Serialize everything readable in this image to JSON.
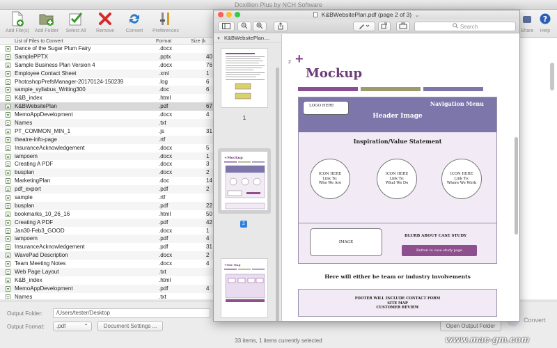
{
  "app": {
    "title": "Doxillion Plus by NCH Software",
    "toolbar": [
      {
        "label": "Add File(s)",
        "icon": "add-file-icon"
      },
      {
        "label": "Add Folder",
        "icon": "add-folder-icon"
      },
      {
        "label": "Select All",
        "icon": "select-all-icon"
      },
      {
        "label": "Remove",
        "icon": "remove-icon"
      },
      {
        "label": "Convert",
        "icon": "convert-icon"
      },
      {
        "label": "Preferences",
        "icon": "preferences-icon"
      }
    ],
    "toolbar_right": [
      {
        "label": "Share",
        "icon": "share-icon"
      },
      {
        "label": "Help",
        "icon": "help-icon"
      }
    ],
    "list_headers": {
      "name": "List of Files to Convert",
      "format": "Format",
      "size": "Size (k"
    },
    "files": [
      {
        "name": "Dance of the Sugar Plum Fairy",
        "format": ".docx",
        "size": ""
      },
      {
        "name": "SamplePPTX",
        "format": ".pptx",
        "size": "40"
      },
      {
        "name": "Sample Business Plan Version 4",
        "format": ".docx",
        "size": "76"
      },
      {
        "name": "Employee Contact Sheet",
        "format": ".xml",
        "size": "1"
      },
      {
        "name": "PhotoshopPrefsManager-20170124-150239",
        "format": ".log",
        "size": "6"
      },
      {
        "name": "sample_syllabus_Writing300",
        "format": ".doc",
        "size": "6"
      },
      {
        "name": "K&B_index",
        "format": ".html",
        "size": ""
      },
      {
        "name": "K&BWebsitePlan",
        "format": ".pdf",
        "size": "67"
      },
      {
        "name": "MemoAppDevelopment",
        "format": ".docx",
        "size": "4"
      },
      {
        "name": "Names",
        "format": ".txt",
        "size": ""
      },
      {
        "name": "PT_COMMON_MIN_1",
        "format": ".js",
        "size": "31"
      },
      {
        "name": "theatre-info-page",
        "format": ".rtf",
        "size": ""
      },
      {
        "name": "InsuranceAcknowledgement",
        "format": ".docx",
        "size": "5"
      },
      {
        "name": "iampoem",
        "format": ".docx",
        "size": "1"
      },
      {
        "name": "Creating A PDF",
        "format": ".docx",
        "size": "3"
      },
      {
        "name": "busplan",
        "format": ".docx",
        "size": "2"
      },
      {
        "name": "MarketingPlan",
        "format": ".doc",
        "size": "14"
      },
      {
        "name": "pdf_export",
        "format": ".pdf",
        "size": "2"
      },
      {
        "name": "sample",
        "format": ".rtf",
        "size": ""
      },
      {
        "name": "busplan",
        "format": ".pdf",
        "size": "22"
      },
      {
        "name": "bookmarks_10_26_16",
        "format": ".html",
        "size": "50"
      },
      {
        "name": "Creating A PDF",
        "format": ".pdf",
        "size": "42"
      },
      {
        "name": "Jan30-Feb3_GOOD",
        "format": ".docx",
        "size": "1"
      },
      {
        "name": "iampoem",
        "format": ".pdf",
        "size": "4"
      },
      {
        "name": "InsuranceAcknowledgement",
        "format": ".pdf",
        "size": "31"
      },
      {
        "name": "WavePad Description",
        "format": ".docx",
        "size": "2"
      },
      {
        "name": "Team Meeting Notes",
        "format": ".docx",
        "size": "4"
      },
      {
        "name": "Web Page Layout",
        "format": ".txt",
        "size": ""
      },
      {
        "name": "K&B_index",
        "format": ".html",
        "size": ""
      },
      {
        "name": "MemoAppDevelopment",
        "format": ".pdf",
        "size": "4"
      },
      {
        "name": "Names",
        "format": ".txt",
        "size": ""
      }
    ],
    "selected_index": 7,
    "output_folder_label": "Output Folder:",
    "output_folder_value": "/Users/tester/Desktop",
    "output_format_label": "Output Format:",
    "output_format_value": ".pdf",
    "document_settings": "Document Settings ...",
    "open_output_folder": "Open Output Folder",
    "convert": "Convert",
    "status": "33 items, 1 items currently selected"
  },
  "preview": {
    "title": "K&BWebsitePlan.pdf (page 2 of 3)",
    "search_placeholder": "Search",
    "sidebar_title": "K&BWebsitePlan....",
    "thumb_labels": [
      "1",
      "2"
    ],
    "doc": {
      "page_number": "2",
      "plus": "+",
      "title": "Mockup",
      "logo": "LOGO HERE",
      "nav": "Navigation Menu",
      "header_image": "Header Image",
      "inspiration": "Inspiration/Value Statement",
      "circles": [
        {
          "l1": "ICON HERE",
          "l2": "Link To:",
          "l3": "Who We Are"
        },
        {
          "l1": "ICON HERE",
          "l2": "Link To:",
          "l3": "What We Do"
        },
        {
          "l1": "ICON HERE",
          "l2": "Link To:",
          "l3": "Where We Work"
        }
      ],
      "image": "IMAGE",
      "blurb": "BLURB ABOUT CASE STUDY",
      "case_button": "Button to case study page",
      "team_text": "Here will either be team or industry involvements",
      "footer_l1": "FOOTER WILL INCLUDE CONTACT FORM",
      "footer_l2": "SITE MAP",
      "footer_l3": "CUSTOMER REVIEW"
    },
    "colors": {
      "purple": "#8b4d93",
      "olive": "#9e9b6a",
      "navy_purple": "#7c76aa",
      "nav_block": "#7c76aa"
    }
  },
  "watermark": "www.mac-gm.com"
}
